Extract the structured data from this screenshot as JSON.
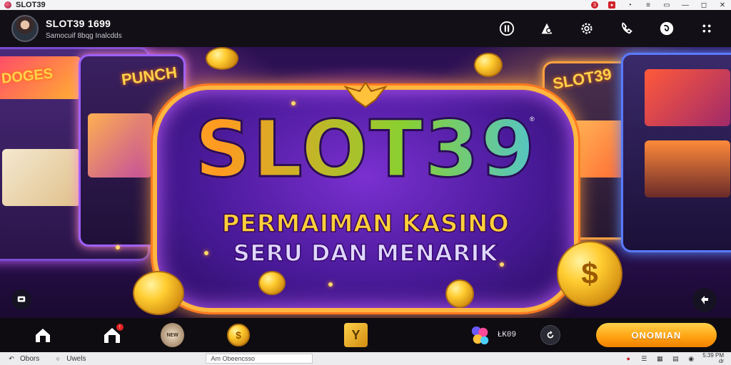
{
  "titlebar": {
    "title": "SLOT39",
    "notification_count": "3",
    "controls": [
      "minimize",
      "maximize",
      "close"
    ]
  },
  "header": {
    "profile_name": "SLOT39 1699",
    "profile_subtitle": "Samocuif 8bqg Inalcdds",
    "icons": [
      "pause-icon",
      "chart-icon",
      "settings-icon",
      "support-icon",
      "globe-icon",
      "more-icon"
    ]
  },
  "banner": {
    "logo": "SLOT39",
    "trademark": "®",
    "tagline_1": "PERMAIMAN KASINO",
    "tagline_2": "SERU DAN MENARIK",
    "machine_tags": [
      "SLOT39",
      "PUNCH",
      "DOGES"
    ],
    "coin_symbol": "$"
  },
  "bottomnav": {
    "balance": "ŁK09",
    "cta_label": "ONOMIAN",
    "pill_text": "NEW",
    "gift_badge": "!",
    "y_label": "Y"
  },
  "taskbar": {
    "back_label": "Obors",
    "search_label": "Uwels",
    "address": "Am Obeencsso",
    "clock_line1": "5:39 PM",
    "clock_line2": "dr"
  },
  "colors": {
    "accent": "#ffa010",
    "panel_border": "#ffb640",
    "panel_fill": "#4a1a9a"
  }
}
